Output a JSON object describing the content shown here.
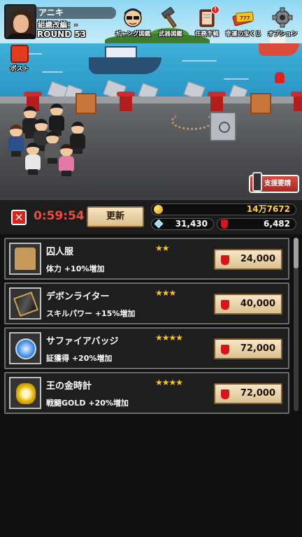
{
  "player": {
    "name": "アニキ",
    "org_label": "組織改編：-",
    "round": "ROUND 53"
  },
  "top_menu": [
    {
      "label": "ギャング図鑑",
      "icon": "gangster-face-icon"
    },
    {
      "label": "武器図鑑",
      "icon": "hammer-icon"
    },
    {
      "label": "任務手帳",
      "icon": "notebook-icon",
      "alert": "!"
    },
    {
      "label": "幸運の宝くじ",
      "icon": "lottery-ticket-icon"
    },
    {
      "label": "オプション",
      "icon": "gear-icon"
    }
  ],
  "post": {
    "label": "ポスト"
  },
  "support": {
    "label": "支援要請"
  },
  "shop": {
    "close_symbol": "✕",
    "timer": "0:59:54",
    "refresh_label": "更新",
    "gold": "14万7672",
    "gems": "31,430",
    "certificates": "6,482"
  },
  "items": [
    {
      "name": "囚人服",
      "stars": "★★",
      "desc": "体力 +10%増加",
      "price": "24,000",
      "icon": "prison-shirt-icon"
    },
    {
      "name": "デボンライター",
      "stars": "★★★",
      "desc": "スキルパワー +15%増加",
      "price": "40,000",
      "icon": "lighter-icon"
    },
    {
      "name": "サファイアバッジ",
      "stars": "★★★★",
      "desc": "証獲得 +20%増加",
      "price": "72,000",
      "icon": "sapphire-badge-icon"
    },
    {
      "name": "王の金時計",
      "stars": "★★★★",
      "desc": "戦闘GOLD +20%増加",
      "price": "72,000",
      "icon": "gold-watch-icon"
    }
  ],
  "colors": {
    "timer": "#f04a3a",
    "stars": "#ffc21c",
    "close_button": "#d8231e",
    "price_button": "#f7e6c6"
  }
}
